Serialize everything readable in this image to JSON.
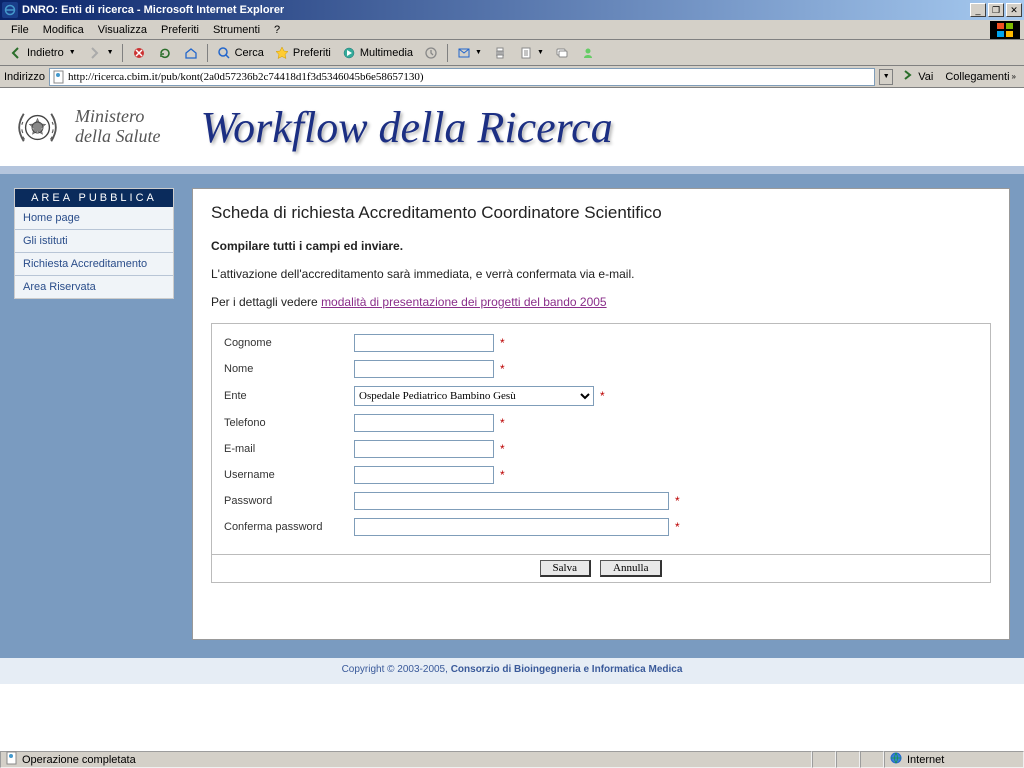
{
  "window": {
    "title": "DNRO: Enti di ricerca - Microsoft Internet Explorer"
  },
  "menubar": {
    "items": [
      "File",
      "Modifica",
      "Visualizza",
      "Preferiti",
      "Strumenti",
      "?"
    ]
  },
  "toolbar": {
    "back": "Indietro",
    "search": "Cerca",
    "favorites": "Preferiti",
    "multimedia": "Multimedia"
  },
  "addressbar": {
    "label": "Indirizzo",
    "url": "http://ricerca.cbim.it/pub/kont(2a0d57236b2c74418d1f3d5346045b6e58657130)",
    "go": "Vai",
    "links": "Collegamenti"
  },
  "banner": {
    "ministero_line1": "Ministero",
    "ministero_line2": "della Salute",
    "workflow_title": "Workflow della Ricerca"
  },
  "sidebar": {
    "header": "AREA PUBBLICA",
    "items": [
      "Home page",
      "Gli istituti",
      "Richiesta Accreditamento",
      "Area Riservata"
    ]
  },
  "form": {
    "heading": "Scheda di richiesta Accreditamento Coordinatore Scientifico",
    "instruction": "Compilare tutti i campi ed inviare.",
    "activation_text": "L'attivazione dell'accreditamento sarà immediata, e verrà confermata via e-mail.",
    "details_prefix": "Per i dettagli vedere ",
    "details_link": "modalità di presentazione dei progetti del bando 2005",
    "fields": {
      "cognome": "Cognome",
      "nome": "Nome",
      "ente": "Ente",
      "telefono": "Telefono",
      "email": "E-mail",
      "username": "Username",
      "password": "Password",
      "conferma": "Conferma password"
    },
    "ente_value": "Ospedale Pediatrico Bambino Gesù",
    "required_mark": "*",
    "save_btn": "Salva",
    "cancel_btn": "Annulla"
  },
  "footer": {
    "copyright_prefix": "Copyright © 2003-2005, ",
    "copyright_org": "Consorzio di Bioingegneria e Informatica Medica"
  },
  "statusbar": {
    "text": "Operazione completata",
    "zone": "Internet"
  }
}
